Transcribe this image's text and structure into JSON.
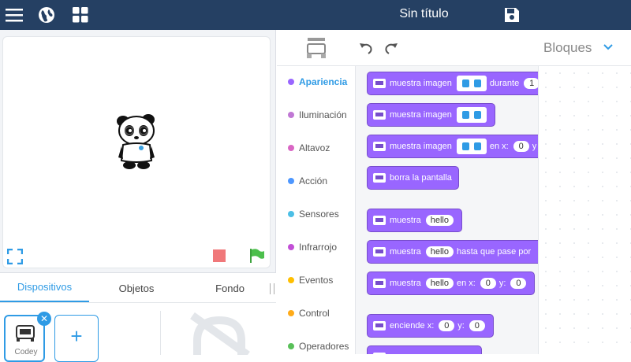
{
  "topbar": {
    "title": "Sin título",
    "icons": [
      "menu-icon",
      "globe-icon",
      "grid-icon",
      "save-icon"
    ]
  },
  "stage": {
    "sprite": "panda",
    "tools": [
      "fullscreen-icon",
      "stop-icon",
      "green-flag-icon"
    ]
  },
  "tabs": [
    {
      "label": "Dispositivos",
      "active": true
    },
    {
      "label": "Objetos",
      "active": false
    },
    {
      "label": "Fondo",
      "active": false
    }
  ],
  "devices": {
    "items": [
      {
        "label": "Codey"
      }
    ],
    "add_label": "+"
  },
  "code": {
    "mode_label": "Bloques",
    "categories": [
      {
        "label": "Apariencia",
        "color": "#9966ff",
        "active": true
      },
      {
        "label": "Iluminación",
        "color": "#c078d4"
      },
      {
        "label": "Altavoz",
        "color": "#d966c4"
      },
      {
        "label": "Acción",
        "color": "#4d97ff"
      },
      {
        "label": "Sensores",
        "color": "#4cbfe6"
      },
      {
        "label": "Infrarrojo",
        "color": "#c24fd6"
      },
      {
        "label": "Eventos",
        "color": "#ffbf00"
      },
      {
        "label": "Control",
        "color": "#ffab19"
      },
      {
        "label": "Operadores",
        "color": "#59c059"
      }
    ],
    "blocks": [
      {
        "t1": "muestra imagen",
        "t2": "durante",
        "n1": "1"
      },
      {
        "t1": "muestra imagen"
      },
      {
        "t1": "muestra imagen",
        "t2": "en x:",
        "n1": "0",
        "t3": "y"
      },
      {
        "t1": "borra la pantalla"
      },
      {
        "t1": "muestra",
        "s1": "hello"
      },
      {
        "t1": "muestra",
        "s1": "hello",
        "t2": "hasta que pase por"
      },
      {
        "t1": "muestra",
        "s1": "hello",
        "t2": "en x:",
        "n1": "0",
        "t3": "y:",
        "n2": "0"
      },
      {
        "t1": "enciende x:",
        "n1": "0",
        "t2": "y:",
        "n2": "0"
      }
    ]
  },
  "colors": {
    "topbar": "#254063",
    "accent": "#2f9be5",
    "looks_block": "#9966ff"
  }
}
